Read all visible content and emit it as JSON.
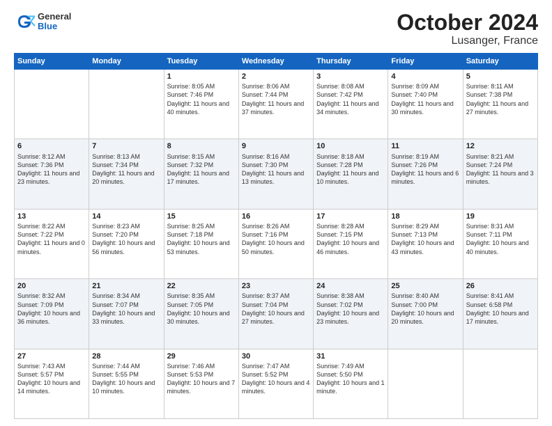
{
  "header": {
    "logo": {
      "general": "General",
      "blue": "Blue"
    },
    "title": "October 2024",
    "subtitle": "Lusanger, France"
  },
  "days_of_week": [
    "Sunday",
    "Monday",
    "Tuesday",
    "Wednesday",
    "Thursday",
    "Friday",
    "Saturday"
  ],
  "weeks": [
    [
      {
        "day": "",
        "info": ""
      },
      {
        "day": "",
        "info": ""
      },
      {
        "day": "1",
        "info": "Sunrise: 8:05 AM\nSunset: 7:46 PM\nDaylight: 11 hours and 40 minutes."
      },
      {
        "day": "2",
        "info": "Sunrise: 8:06 AM\nSunset: 7:44 PM\nDaylight: 11 hours and 37 minutes."
      },
      {
        "day": "3",
        "info": "Sunrise: 8:08 AM\nSunset: 7:42 PM\nDaylight: 11 hours and 34 minutes."
      },
      {
        "day": "4",
        "info": "Sunrise: 8:09 AM\nSunset: 7:40 PM\nDaylight: 11 hours and 30 minutes."
      },
      {
        "day": "5",
        "info": "Sunrise: 8:11 AM\nSunset: 7:38 PM\nDaylight: 11 hours and 27 minutes."
      }
    ],
    [
      {
        "day": "6",
        "info": "Sunrise: 8:12 AM\nSunset: 7:36 PM\nDaylight: 11 hours and 23 minutes."
      },
      {
        "day": "7",
        "info": "Sunrise: 8:13 AM\nSunset: 7:34 PM\nDaylight: 11 hours and 20 minutes."
      },
      {
        "day": "8",
        "info": "Sunrise: 8:15 AM\nSunset: 7:32 PM\nDaylight: 11 hours and 17 minutes."
      },
      {
        "day": "9",
        "info": "Sunrise: 8:16 AM\nSunset: 7:30 PM\nDaylight: 11 hours and 13 minutes."
      },
      {
        "day": "10",
        "info": "Sunrise: 8:18 AM\nSunset: 7:28 PM\nDaylight: 11 hours and 10 minutes."
      },
      {
        "day": "11",
        "info": "Sunrise: 8:19 AM\nSunset: 7:26 PM\nDaylight: 11 hours and 6 minutes."
      },
      {
        "day": "12",
        "info": "Sunrise: 8:21 AM\nSunset: 7:24 PM\nDaylight: 11 hours and 3 minutes."
      }
    ],
    [
      {
        "day": "13",
        "info": "Sunrise: 8:22 AM\nSunset: 7:22 PM\nDaylight: 11 hours and 0 minutes."
      },
      {
        "day": "14",
        "info": "Sunrise: 8:23 AM\nSunset: 7:20 PM\nDaylight: 10 hours and 56 minutes."
      },
      {
        "day": "15",
        "info": "Sunrise: 8:25 AM\nSunset: 7:18 PM\nDaylight: 10 hours and 53 minutes."
      },
      {
        "day": "16",
        "info": "Sunrise: 8:26 AM\nSunset: 7:16 PM\nDaylight: 10 hours and 50 minutes."
      },
      {
        "day": "17",
        "info": "Sunrise: 8:28 AM\nSunset: 7:15 PM\nDaylight: 10 hours and 46 minutes."
      },
      {
        "day": "18",
        "info": "Sunrise: 8:29 AM\nSunset: 7:13 PM\nDaylight: 10 hours and 43 minutes."
      },
      {
        "day": "19",
        "info": "Sunrise: 8:31 AM\nSunset: 7:11 PM\nDaylight: 10 hours and 40 minutes."
      }
    ],
    [
      {
        "day": "20",
        "info": "Sunrise: 8:32 AM\nSunset: 7:09 PM\nDaylight: 10 hours and 36 minutes."
      },
      {
        "day": "21",
        "info": "Sunrise: 8:34 AM\nSunset: 7:07 PM\nDaylight: 10 hours and 33 minutes."
      },
      {
        "day": "22",
        "info": "Sunrise: 8:35 AM\nSunset: 7:05 PM\nDaylight: 10 hours and 30 minutes."
      },
      {
        "day": "23",
        "info": "Sunrise: 8:37 AM\nSunset: 7:04 PM\nDaylight: 10 hours and 27 minutes."
      },
      {
        "day": "24",
        "info": "Sunrise: 8:38 AM\nSunset: 7:02 PM\nDaylight: 10 hours and 23 minutes."
      },
      {
        "day": "25",
        "info": "Sunrise: 8:40 AM\nSunset: 7:00 PM\nDaylight: 10 hours and 20 minutes."
      },
      {
        "day": "26",
        "info": "Sunrise: 8:41 AM\nSunset: 6:58 PM\nDaylight: 10 hours and 17 minutes."
      }
    ],
    [
      {
        "day": "27",
        "info": "Sunrise: 7:43 AM\nSunset: 5:57 PM\nDaylight: 10 hours and 14 minutes."
      },
      {
        "day": "28",
        "info": "Sunrise: 7:44 AM\nSunset: 5:55 PM\nDaylight: 10 hours and 10 minutes."
      },
      {
        "day": "29",
        "info": "Sunrise: 7:46 AM\nSunset: 5:53 PM\nDaylight: 10 hours and 7 minutes."
      },
      {
        "day": "30",
        "info": "Sunrise: 7:47 AM\nSunset: 5:52 PM\nDaylight: 10 hours and 4 minutes."
      },
      {
        "day": "31",
        "info": "Sunrise: 7:49 AM\nSunset: 5:50 PM\nDaylight: 10 hours and 1 minute."
      },
      {
        "day": "",
        "info": ""
      },
      {
        "day": "",
        "info": ""
      }
    ]
  ]
}
